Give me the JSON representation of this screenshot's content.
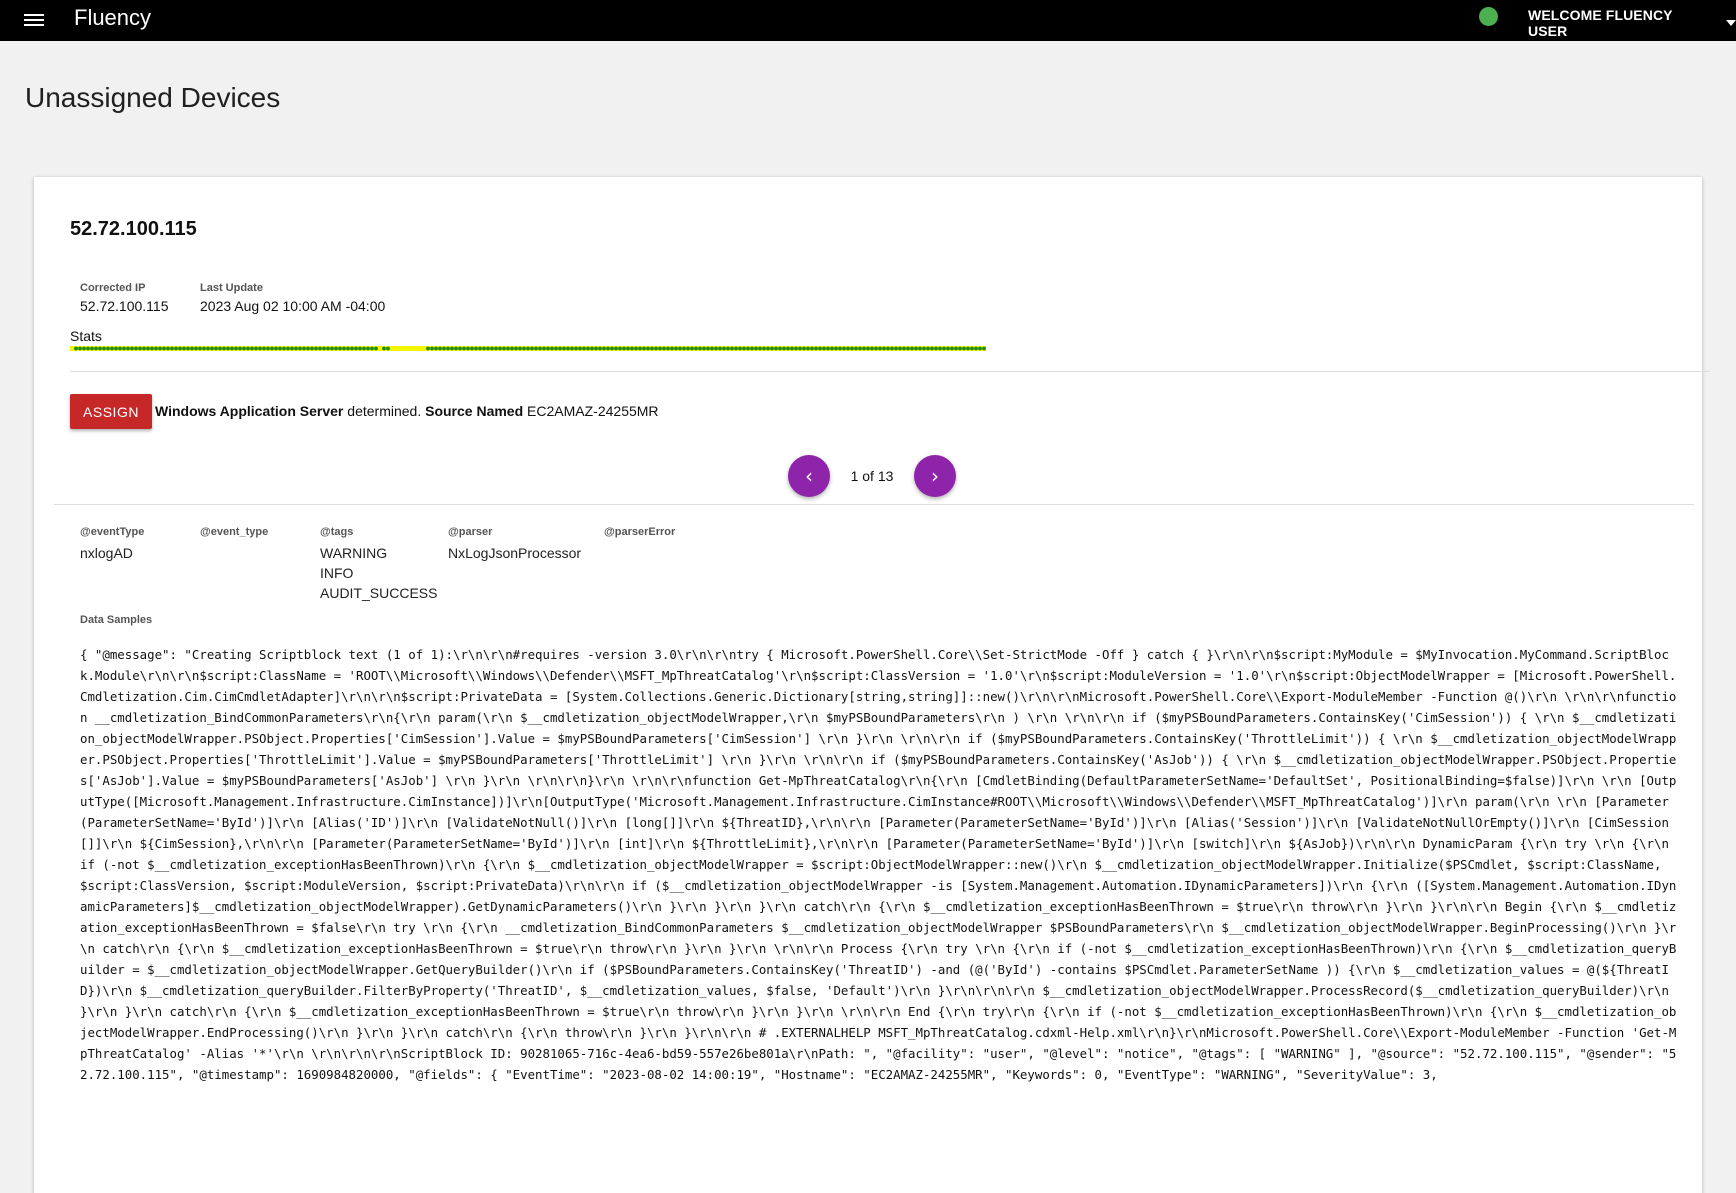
{
  "header": {
    "app_title": "Fluency",
    "menu_icon": "hamburger-menu-icon",
    "status_color": "#4caf50",
    "user_label": "WELCOME FLUENCY USER"
  },
  "page": {
    "title": "Unassigned Devices"
  },
  "device": {
    "ip": "52.72.100.115",
    "corrected_ip_label": "Corrected IP",
    "corrected_ip": "52.72.100.115",
    "last_update_label": "Last Update",
    "last_update": "2023 Aug 02 10:00 AM -04:00",
    "stats_label": "Stats"
  },
  "assign": {
    "button_label": "ASSIGN",
    "server_type": "Windows Application Server",
    "determined_text": " determined. ",
    "source_named_label": "Source Named",
    "source_name": " EC2AMAZ-24255MR"
  },
  "pager": {
    "text": "1 of 13",
    "prev_icon": "chevron-left-icon",
    "next_icon": "chevron-right-icon"
  },
  "attributes": {
    "eventType": {
      "label": "@eventType",
      "values": [
        "nxlogAD"
      ]
    },
    "event_type": {
      "label": "@event_type",
      "values": []
    },
    "tags": {
      "label": "@tags",
      "values": [
        "WARNING",
        "INFO",
        "AUDIT_SUCCESS"
      ]
    },
    "parser": {
      "label": "@parser",
      "values": [
        "NxLogJsonProcessor"
      ]
    },
    "parserError": {
      "label": "@parserError",
      "values": []
    }
  },
  "data_samples": {
    "label": "Data Samples",
    "text": "{ \"@message\": \"Creating Scriptblock text (1 of 1):\\r\\n\\r\\n#requires -version 3.0\\r\\n\\r\\ntry { Microsoft.PowerShell.Core\\\\Set-StrictMode -Off } catch { }\\r\\n\\r\\n$script:MyModule = $MyInvocation.MyCommand.ScriptBlock.Module\\r\\n\\r\\n$script:ClassName = 'ROOT\\\\Microsoft\\\\Windows\\\\Defender\\\\MSFT_MpThreatCatalog'\\r\\n$script:ClassVersion = '1.0'\\r\\n$script:ModuleVersion = '1.0'\\r\\n$script:ObjectModelWrapper = [Microsoft.PowerShell.Cmdletization.Cim.CimCmdletAdapter]\\r\\n\\r\\n$script:PrivateData = [System.Collections.Generic.Dictionary[string,string]]::new()\\r\\n\\r\\nMicrosoft.PowerShell.Core\\\\Export-ModuleMember -Function @()\\r\\n \\r\\n\\r\\nfunction __cmdletization_BindCommonParameters\\r\\n{\\r\\n param(\\r\\n $__cmdletization_objectModelWrapper,\\r\\n $myPSBoundParameters\\r\\n ) \\r\\n \\r\\n\\r\\n if ($myPSBoundParameters.ContainsKey('CimSession')) { \\r\\n $__cmdletization_objectModelWrapper.PSObject.Properties['CimSession'].Value = $myPSBoundParameters['CimSession'] \\r\\n }\\r\\n \\r\\n\\r\\n if ($myPSBoundParameters.ContainsKey('ThrottleLimit')) { \\r\\n $__cmdletization_objectModelWrapper.PSObject.Properties['ThrottleLimit'].Value = $myPSBoundParameters['ThrottleLimit'] \\r\\n }\\r\\n \\r\\n\\r\\n if ($myPSBoundParameters.ContainsKey('AsJob')) { \\r\\n $__cmdletization_objectModelWrapper.PSObject.Properties['AsJob'].Value = $myPSBoundParameters['AsJob'] \\r\\n }\\r\\n \\r\\n\\r\\n}\\r\\n \\r\\n\\r\\nfunction Get-MpThreatCatalog\\r\\n{\\r\\n [CmdletBinding(DefaultParameterSetName='DefaultSet', PositionalBinding=$false)]\\r\\n \\r\\n [OutputType([Microsoft.Management.Infrastructure.CimInstance])]\\r\\n[OutputType('Microsoft.Management.Infrastructure.CimInstance#ROOT\\\\Microsoft\\\\Windows\\\\Defender\\\\MSFT_MpThreatCatalog')]\\r\\n param(\\r\\n \\r\\n [Parameter(ParameterSetName='ById')]\\r\\n [Alias('ID')]\\r\\n [ValidateNotNull()]\\r\\n [long[]]\\r\\n ${ThreatID},\\r\\n\\r\\n [Parameter(ParameterSetName='ById')]\\r\\n [Alias('Session')]\\r\\n [ValidateNotNullOrEmpty()]\\r\\n [CimSession[]]\\r\\n ${CimSession},\\r\\n\\r\\n [Parameter(ParameterSetName='ById')]\\r\\n [int]\\r\\n ${ThrottleLimit},\\r\\n\\r\\n [Parameter(ParameterSetName='ById')]\\r\\n [switch]\\r\\n ${AsJob})\\r\\n\\r\\n DynamicParam {\\r\\n try \\r\\n {\\r\\n if (-not $__cmdletization_exceptionHasBeenThrown)\\r\\n {\\r\\n $__cmdletization_objectModelWrapper = $script:ObjectModelWrapper::new()\\r\\n $__cmdletization_objectModelWrapper.Initialize($PSCmdlet, $script:ClassName, $script:ClassVersion, $script:ModuleVersion, $script:PrivateData)\\r\\n\\r\\n if ($__cmdletization_objectModelWrapper -is [System.Management.Automation.IDynamicParameters])\\r\\n {\\r\\n ([System.Management.Automation.IDynamicParameters]$__cmdletization_objectModelWrapper).GetDynamicParameters()\\r\\n }\\r\\n }\\r\\n }\\r\\n catch\\r\\n {\\r\\n $__cmdletization_exceptionHasBeenThrown = $true\\r\\n throw\\r\\n }\\r\\n }\\r\\n\\r\\n Begin {\\r\\n $__cmdletization_exceptionHasBeenThrown = $false\\r\\n try \\r\\n {\\r\\n __cmdletization_BindCommonParameters $__cmdletization_objectModelWrapper $PSBoundParameters\\r\\n $__cmdletization_objectModelWrapper.BeginProcessing()\\r\\n }\\r\\n catch\\r\\n {\\r\\n $__cmdletization_exceptionHasBeenThrown = $true\\r\\n throw\\r\\n }\\r\\n }\\r\\n \\r\\n\\r\\n Process {\\r\\n try \\r\\n {\\r\\n if (-not $__cmdletization_exceptionHasBeenThrown)\\r\\n {\\r\\n $__cmdletization_queryBuilder = $__cmdletization_objectModelWrapper.GetQueryBuilder()\\r\\n if ($PSBoundParameters.ContainsKey('ThreatID') -and (@('ById') -contains $PSCmdlet.ParameterSetName )) {\\r\\n $__cmdletization_values = @(${ThreatID})\\r\\n $__cmdletization_queryBuilder.FilterByProperty('ThreatID', $__cmdletization_values, $false, 'Default')\\r\\n }\\r\\n\\r\\n\\r\\n $__cmdletization_objectModelWrapper.ProcessRecord($__cmdletization_queryBuilder)\\r\\n }\\r\\n }\\r\\n catch\\r\\n {\\r\\n $__cmdletization_exceptionHasBeenThrown = $true\\r\\n throw\\r\\n }\\r\\n }\\r\\n \\r\\n\\r\\n End {\\r\\n try\\r\\n {\\r\\n if (-not $__cmdletization_exceptionHasBeenThrown)\\r\\n {\\r\\n $__cmdletization_objectModelWrapper.EndProcessing()\\r\\n }\\r\\n }\\r\\n catch\\r\\n {\\r\\n throw\\r\\n }\\r\\n }\\r\\n\\r\\n # .EXTERNALHELP MSFT_MpThreatCatalog.cdxml-Help.xml\\r\\n}\\r\\nMicrosoft.PowerShell.Core\\\\Export-ModuleMember -Function 'Get-MpThreatCatalog' -Alias '*'\\r\\n \\r\\n\\r\\n\\r\\nScriptBlock ID: 90281065-716c-4ea6-bd59-557e26be801a\\r\\nPath: \", \"@facility\": \"user\", \"@level\": \"notice\", \"@tags\": [ \"WARNING\" ], \"@source\": \"52.72.100.115\", \"@sender\": \"52.72.100.115\", \"@timestamp\": 1690984820000, \"@fields\": { \"EventTime\": \"2023-08-02 14:00:19\", \"Hostname\": \"EC2AMAZ-24255MR\", \"Keywords\": 0, \"EventType\": \"WARNING\", \"SeverityValue\": 3,"
  },
  "colors": {
    "topbar_bg": "#000000",
    "assign_red": "#c62828",
    "pager_purple": "#8e24aa",
    "stat_green": "#1b8a1b",
    "stat_yellow": "#f5f500"
  }
}
